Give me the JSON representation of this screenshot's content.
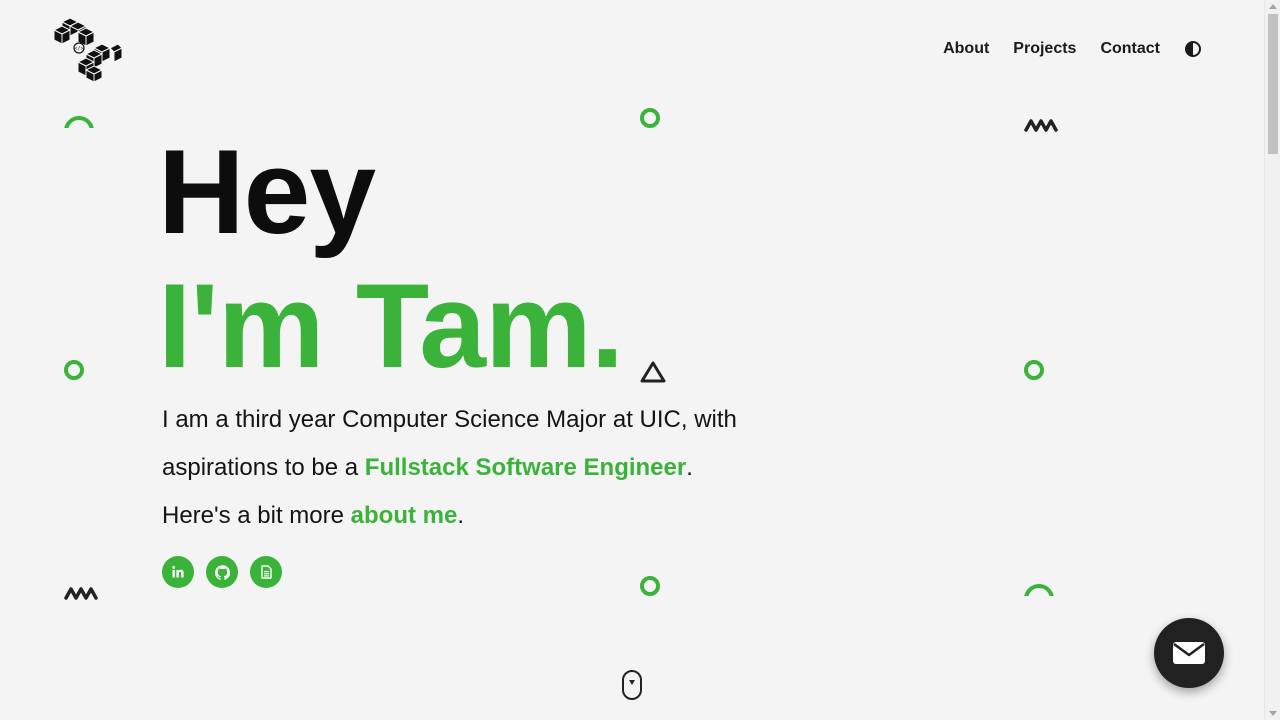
{
  "header": {
    "logo_icon": "cubes-logo-icon",
    "nav": [
      {
        "label": "About"
      },
      {
        "label": "Projects"
      },
      {
        "label": "Contact"
      }
    ],
    "theme_toggle_icon": "contrast-icon"
  },
  "hero": {
    "line1": "Hey",
    "line2": "I'm Tam.",
    "bio": {
      "part1": "I am a third year Computer Science Major at UIC, with aspirations to be a ",
      "highlight": "Fullstack Software Engineer",
      "part2": ".",
      "part3": "Here's a bit more ",
      "link": "about me",
      "part4": "."
    },
    "socials": [
      {
        "icon": "linkedin-icon"
      },
      {
        "icon": "github-icon"
      },
      {
        "icon": "resume-document-icon"
      }
    ]
  },
  "scroll_indicator_icon": "mouse-scroll-icon",
  "mail_button_icon": "envelope-icon",
  "colors": {
    "accent": "#3bb33b",
    "background": "#f4f4f4",
    "text": "#111111",
    "fab": "#212121"
  }
}
